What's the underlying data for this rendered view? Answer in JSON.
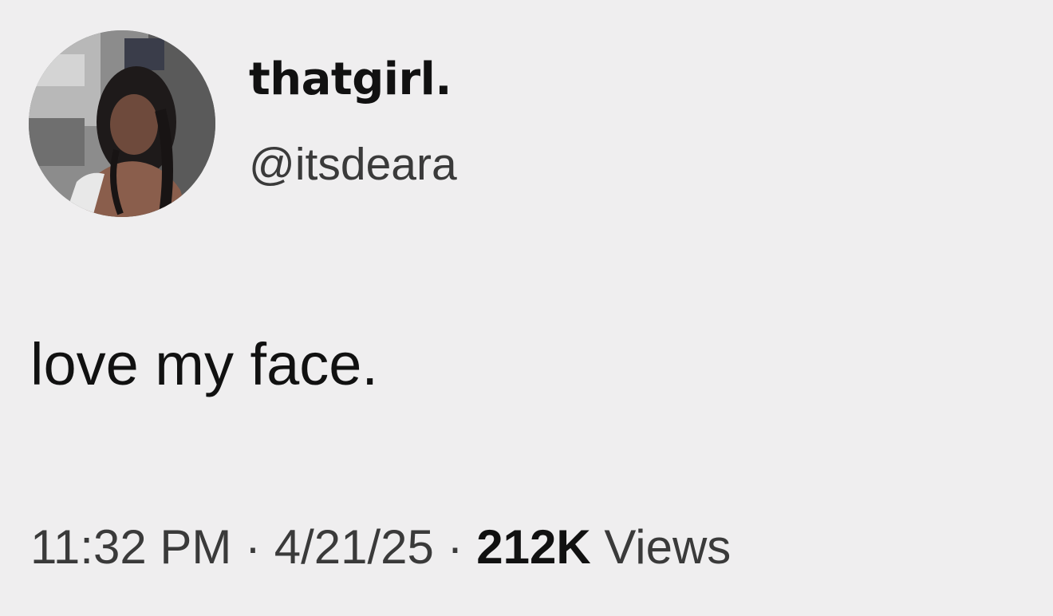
{
  "author": {
    "display_name": "thatgirl.",
    "handle": "@itsdeara",
    "avatar_alt": "profile photo"
  },
  "tweet": {
    "text": "love my face."
  },
  "meta": {
    "time": "11:32 PM",
    "separator": " · ",
    "date": "4/21/25",
    "views_count": "212K",
    "views_label": " Views"
  }
}
